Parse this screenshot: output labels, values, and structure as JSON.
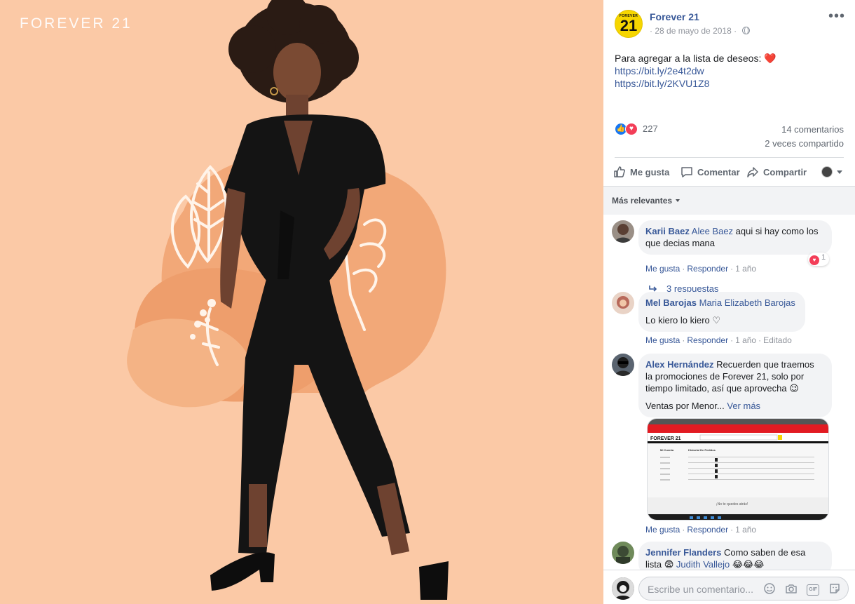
{
  "photo": {
    "watermark": "FOREVER 21",
    "colors": {
      "background": "#fbc9a6",
      "blob_dark": "#f0a070",
      "blob_light": "#f5b488",
      "jumpsuit": "#141414"
    }
  },
  "post": {
    "page_name": "Forever 21",
    "avatar_small": "FOREVER",
    "avatar_big": "21",
    "date": "28 de mayo de 2018",
    "text": "Para agregar a la lista de deseos: ",
    "heart": "❤️",
    "links": [
      "https://bit.ly/2e4t2dw",
      "https://bit.ly/2KVU1Z8"
    ],
    "reactions_count": "227",
    "comments_count": "14 comentarios",
    "shares_count": "2 veces compartido"
  },
  "actions": {
    "like": "Me gusta",
    "comment": "Comentar",
    "share": "Compartir"
  },
  "sort": {
    "label": "Más relevantes"
  },
  "comments": [
    {
      "author": "Karii Baez",
      "tag": "Alee Baez",
      "text_line1": " aqui si hay como los",
      "text_line2": "que decias mana",
      "like": "Me gusta",
      "reply": "Responder",
      "time": "1 año",
      "reaction_count": "1",
      "replies": "3 respuestas"
    },
    {
      "author": "Mel Barojas",
      "tag": "Maria Elizabeth Barojas",
      "text_line2": "Lo kiero lo kiero ♡",
      "like": "Me gusta",
      "reply": "Responder",
      "time": "1 año",
      "edited": "Editado"
    },
    {
      "author": "Alex Hernández",
      "text_line1": " Recuerden que traemos",
      "text_line2": "la promociones de Forever 21, solo por",
      "text_line3": "tiempo limitado, así que aprovecha 😉",
      "text_line4": "Ventas por Menor...",
      "see_more": "Ver más",
      "like": "Me gusta",
      "reply": "Responder",
      "time": "1 año"
    },
    {
      "author": "Jennifer Flanders",
      "text_line1": " Como saben de esa",
      "text_line2": "lista 😨 ",
      "tag": "Judith Vallejo",
      "emojis": " 😂😂😂"
    }
  ],
  "attachment": {
    "banner_logo": "FOREVER 21",
    "account_title": "Mi Cuenta",
    "orders_title": "Historial De Pedidos",
    "footer_text": "¡No te quedes atrás!"
  },
  "composer": {
    "placeholder": "Escribe un comentario..."
  }
}
